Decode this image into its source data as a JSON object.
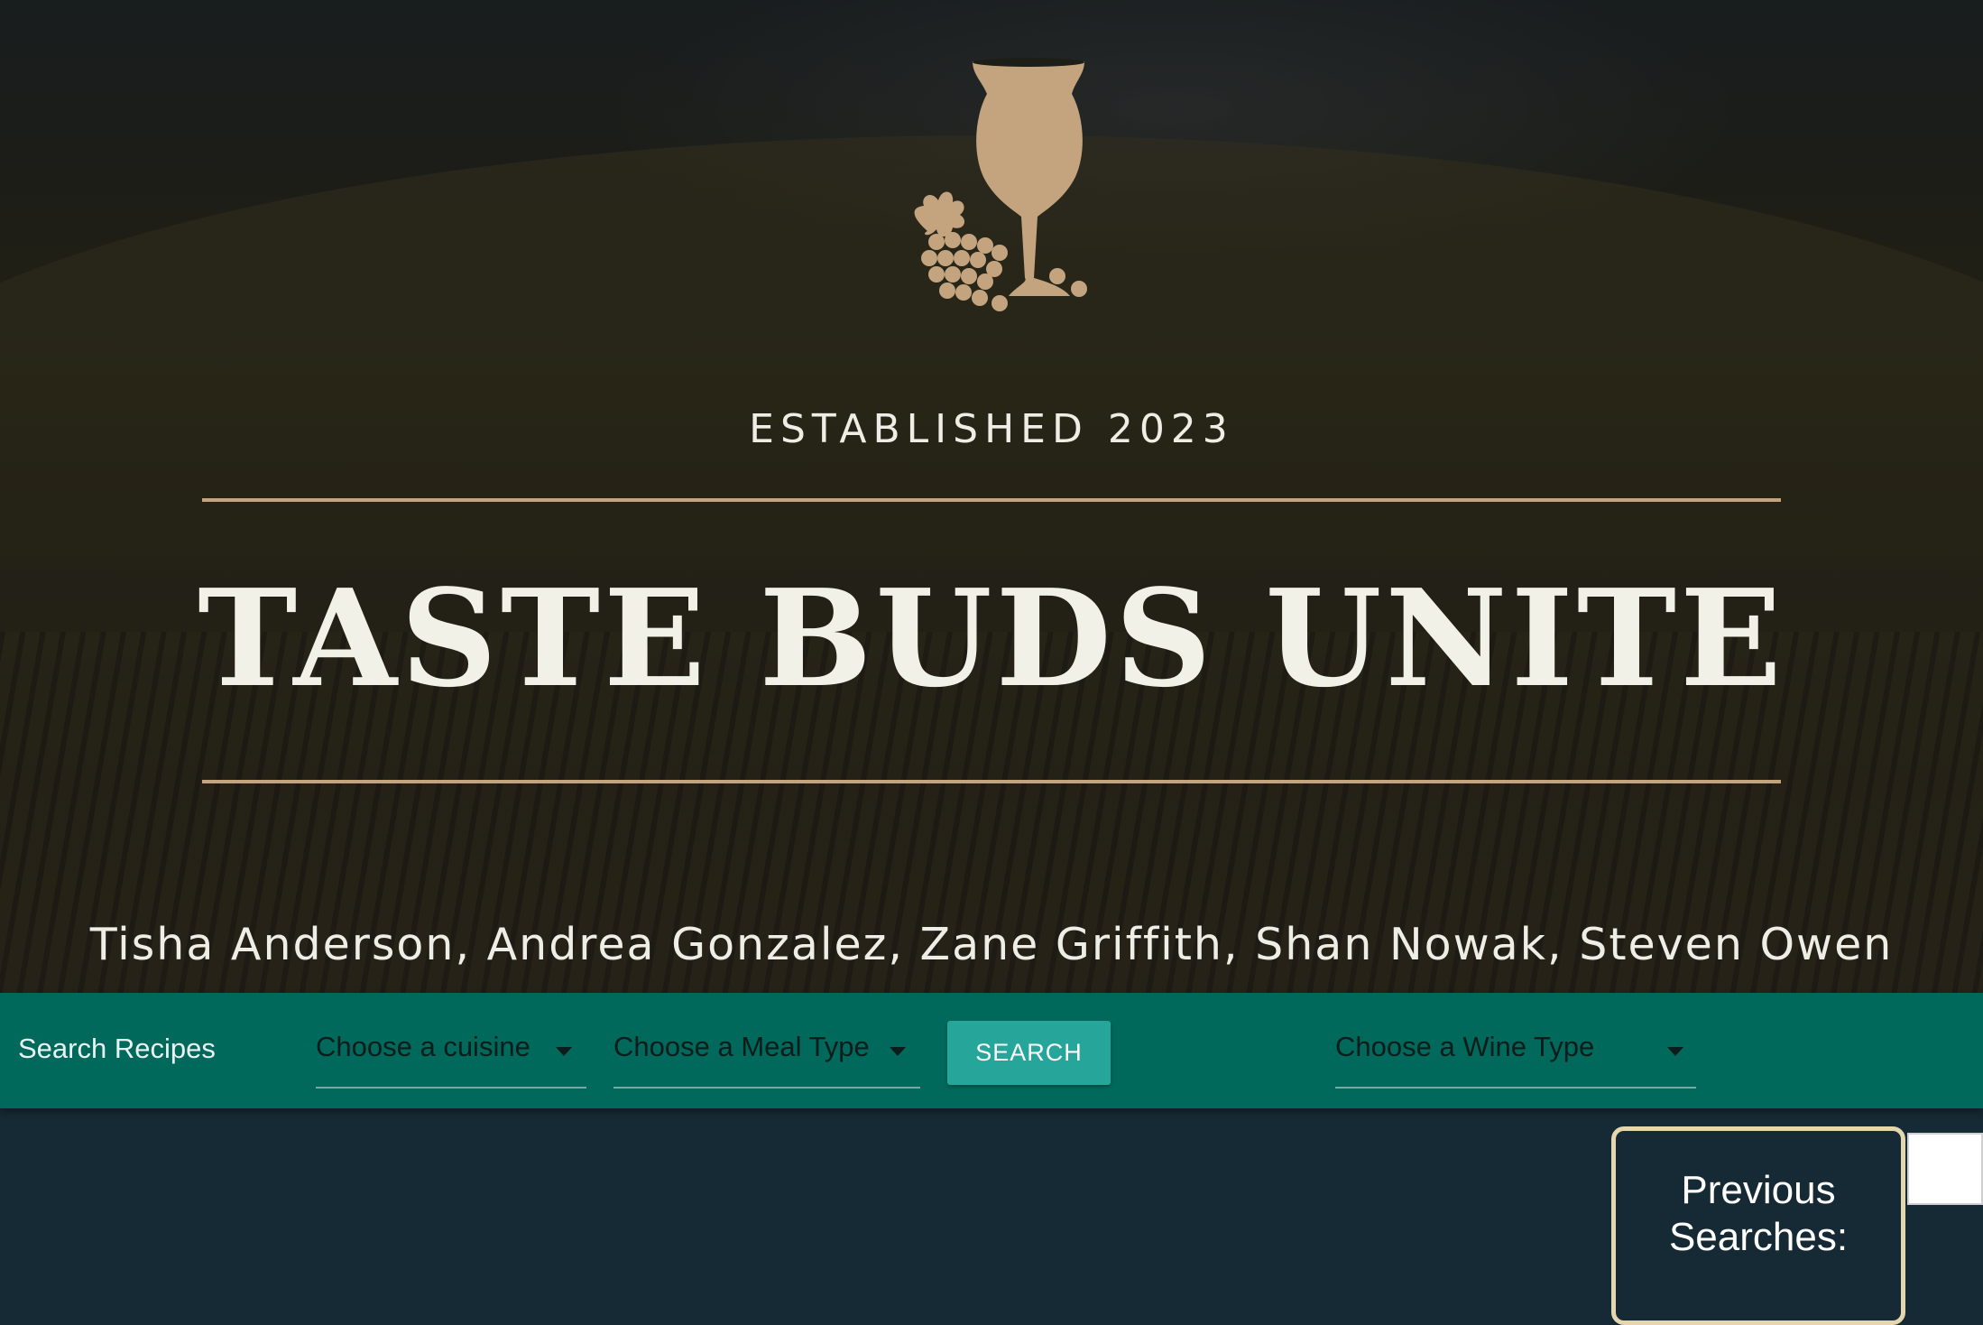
{
  "hero": {
    "logo_icon": "wine-glass-grapes-icon",
    "established": "ESTABLISHED 2023",
    "title": "TASTE BUDS UNITE",
    "authors": "Tisha Anderson, Andrea Gonzalez, Zane Griffith, Shan Nowak, Steven Owen"
  },
  "navbar": {
    "label": "Search Recipes",
    "cuisine_select": "Choose a cuisine",
    "meal_select": "Choose a Meal Type",
    "search_button": "SEARCH",
    "wine_select": "Choose a Wine Type"
  },
  "sidebar": {
    "previous_searches_title": "Previous Searches:"
  },
  "colors": {
    "accent_gold": "#c4a47f",
    "navbar_teal": "#00695c",
    "button_teal": "#26a69a",
    "page_bg": "#152a35",
    "card_border": "#e5d6ae"
  }
}
